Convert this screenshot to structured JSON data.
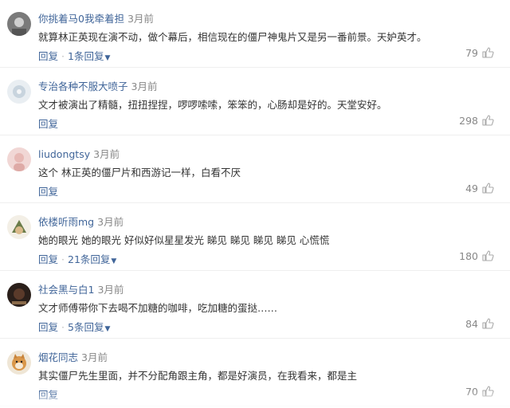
{
  "colors": {
    "username": "#406599",
    "body_text": "#333333",
    "meta_text": "#888888",
    "link": "#406599",
    "divider": "#efefef"
  },
  "comments": [
    {
      "avatar": "gray-thumbnail-avatar",
      "username": "你挑着马0我牵着担",
      "time": "3月前",
      "text": "就算林正英现在演不动，做个幕后，相信现在的僵尸神鬼片又是另一番前景。天妒英才。",
      "reply_label": "回复",
      "reply_count_label": "1条回复",
      "likes": "79"
    },
    {
      "avatar": "light-flower-avatar",
      "username": "专治各种不服大喷子",
      "time": "3月前",
      "text": "文才被演出了精髓，扭扭捏捏，啰啰嗦嗦，笨笨的，心肠却是好的。天堂安好。",
      "reply_label": "回复",
      "reply_count_label": "",
      "likes": "298"
    },
    {
      "avatar": "pink-avatar",
      "username": "liudongtsy",
      "time": "3月前",
      "text": "这个 林正英的僵尸片和西游记一样，白看不厌",
      "reply_label": "回复",
      "reply_count_label": "",
      "likes": "49"
    },
    {
      "avatar": "character-avatar",
      "username": "依楼听雨mg",
      "time": "3月前",
      "text": "她的眼光 她的眼光 好似好似星星发光 睇见 睇见 睇见 睇见 心慌慌",
      "reply_label": "回复",
      "reply_count_label": "21条回复",
      "likes": "180"
    },
    {
      "avatar": "dark-avatar",
      "username": "社会黑与白1",
      "time": "3月前",
      "text": "文才师傅带你下去喝不加糖的咖啡，吃加糖的蛋挞……",
      "reply_label": "回复",
      "reply_count_label": "5条回复",
      "likes": "84"
    },
    {
      "avatar": "shiba-dog-avatar",
      "username": "烟花同志",
      "time": "3月前",
      "text": "其实僵尸先生里面，并不分配角跟主角，都是好演员，在我看来，都是主",
      "reply_label": "回复",
      "reply_count_label": "",
      "likes": "70"
    }
  ]
}
